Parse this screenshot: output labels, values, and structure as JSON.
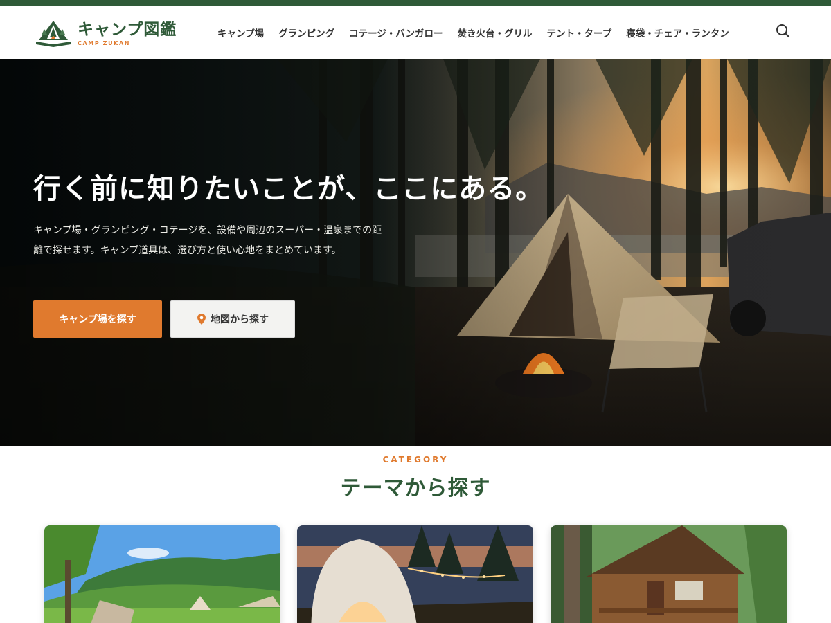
{
  "brand": {
    "name": "キャンプ図鑑",
    "sub": "CAMP ZUKAN",
    "primary_color": "#2f5a38",
    "accent_color": "#e07a2e"
  },
  "nav": {
    "items": [
      {
        "label": "キャンプ場"
      },
      {
        "label": "グランピング"
      },
      {
        "label": "コテージ・バンガロー"
      },
      {
        "label": "焚き火台・グリル"
      },
      {
        "label": "テント・タープ"
      },
      {
        "label": "寝袋・チェア・ランタン"
      }
    ],
    "search_icon": "search-icon"
  },
  "hero": {
    "title": "行く前に知りたいことが、ここにある。",
    "description": "キャンプ場・グランピング・コテージを、設備や周辺のスーパー・温泉までの距離で探せます。キャンプ道具は、選び方と使い心地をまとめています。",
    "primary_button": "キャンプ場を探す",
    "secondary_button": "地図から探す",
    "secondary_icon": "map-pin-icon"
  },
  "category": {
    "label": "CATEGORY",
    "title": "テーマから探す",
    "cards": [
      {
        "name": "campground"
      },
      {
        "name": "glamping-dome"
      },
      {
        "name": "log-cabin"
      }
    ]
  }
}
